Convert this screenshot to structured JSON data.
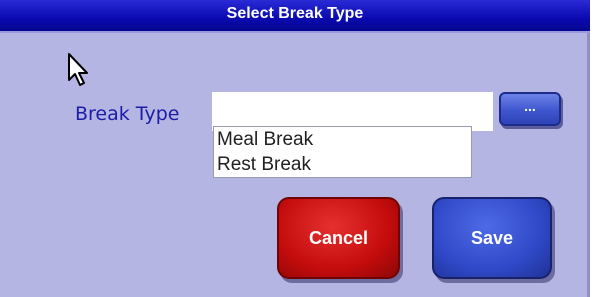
{
  "dialog": {
    "title": "Select Break Type"
  },
  "form": {
    "break_type_label": "Break Type",
    "break_type_value": "",
    "browse_label": "..."
  },
  "dropdown": {
    "options": [
      "Meal Break",
      "Rest Break"
    ]
  },
  "buttons": {
    "cancel_label": "Cancel",
    "save_label": "Save"
  },
  "icons": {
    "cursor": "mouse-pointer-icon"
  },
  "colors": {
    "title_bar": "#0a0ab0",
    "dialog_bg": "#b4b5e3",
    "label": "#1c1ca6",
    "cancel": "#c40c0c",
    "save": "#2f49c8"
  }
}
